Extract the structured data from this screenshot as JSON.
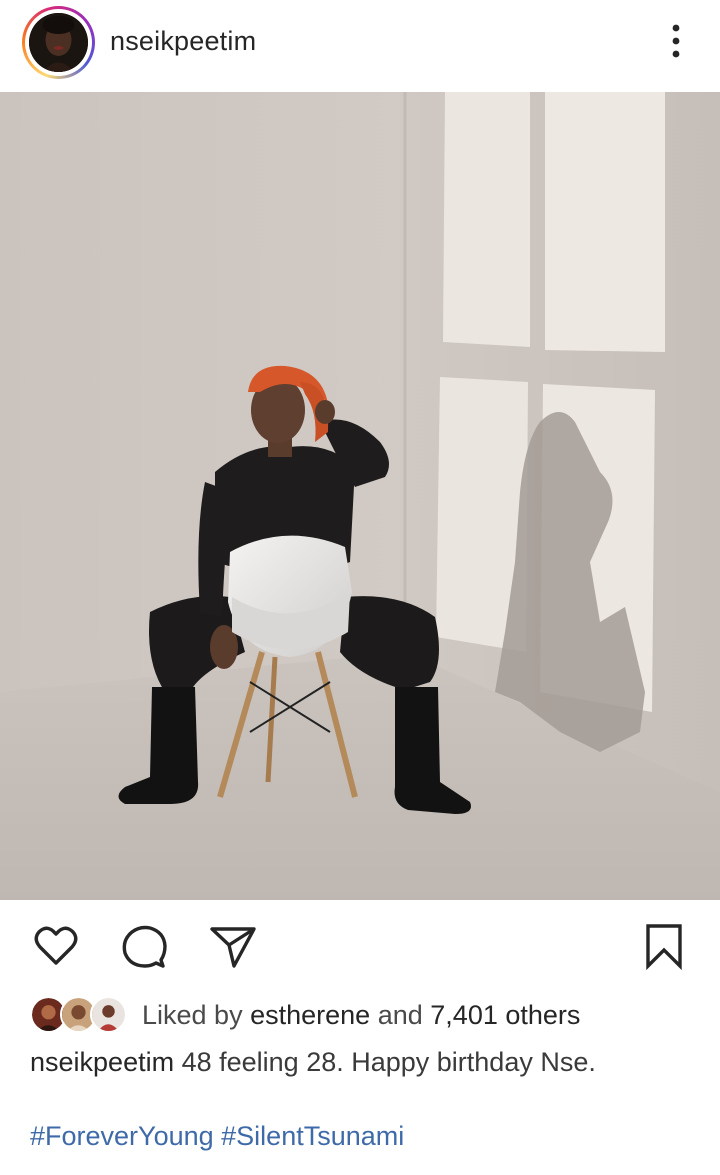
{
  "post": {
    "username": "nseikpeetim",
    "photo_alt": ""
  },
  "icons": {
    "more": "more-vertical-icon",
    "like": "heart-icon",
    "comment": "comment-icon",
    "share": "send-icon",
    "save": "bookmark-icon"
  },
  "likes": {
    "prefix": "Liked by",
    "user": "estherene",
    "middle": "and",
    "count": "7,401 others"
  },
  "caption": {
    "username": "nseikpeetim",
    "text": "48 feeling 28. Happy birthday Nse.",
    "hashtags": [
      "#ForeverYoung",
      "#SilentTsunami"
    ]
  },
  "colors": {
    "text": "#262626",
    "hashtag": "#3f6aa8",
    "story_ring": "#d62976"
  }
}
